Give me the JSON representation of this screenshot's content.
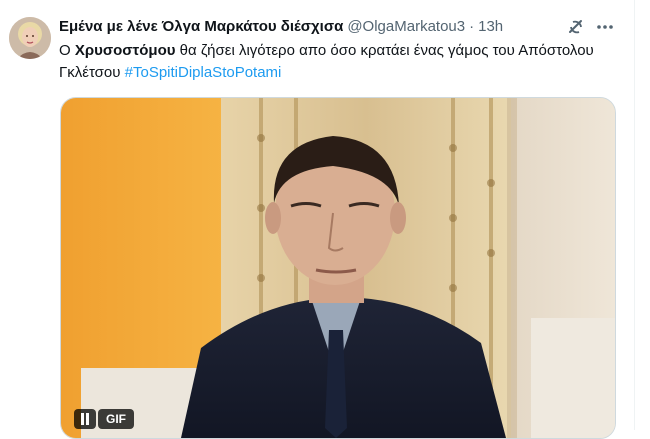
{
  "tweet": {
    "display_name": "Εμένα με λένε Όλγα Μαρκάτου διέσχισα",
    "handle": "@OlgaMarkatou3",
    "separator": "·",
    "time": "13h",
    "text": {
      "part1": "Ο ",
      "bold": "Χρυσοστόμου",
      "part2": " θα ζήσει λιγότερο απο όσο κρατάει ένας γάμος του Απόστολου Γκλέτσου ",
      "hashtag": "#ToSpitiDiplaStoPotami"
    },
    "media": {
      "badge": "GIF"
    },
    "icons": {
      "grok": "grok-icon",
      "more": "more-icon",
      "pause": "pause-icon"
    },
    "colors": {
      "accent": "#1d9bf0",
      "secondary_text": "#536471",
      "primary_text": "#0f1419"
    }
  }
}
